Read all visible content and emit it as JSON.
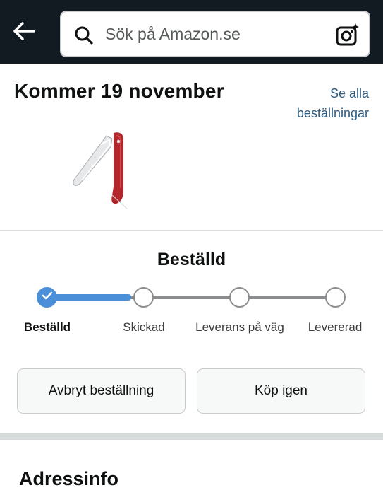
{
  "header": {
    "search_placeholder": "Sök på Amazon.se",
    "icons": [
      "back-arrow-icon",
      "search-icon",
      "camera-icon"
    ]
  },
  "delivery": {
    "title": "Kommer 19 november",
    "see_all": "Se alla beställningar"
  },
  "tracker": {
    "status_title": "Beställd",
    "current_step": 1,
    "total_steps": 4,
    "steps": [
      {
        "label": "Beställd",
        "done": true
      },
      {
        "label": "Skickad",
        "done": false
      },
      {
        "label": "Leverans på väg",
        "done": false
      },
      {
        "label": "Levererad",
        "done": false
      }
    ]
  },
  "actions": {
    "cancel_label": "Avbryt beställning",
    "buy_again_label": "Köp igen"
  },
  "address": {
    "title": "Adressinfo"
  },
  "colors": {
    "header_bg": "#121a22",
    "link": "#2e5c80",
    "progress": "#4a8fd8",
    "band": "#d5dbdb"
  }
}
